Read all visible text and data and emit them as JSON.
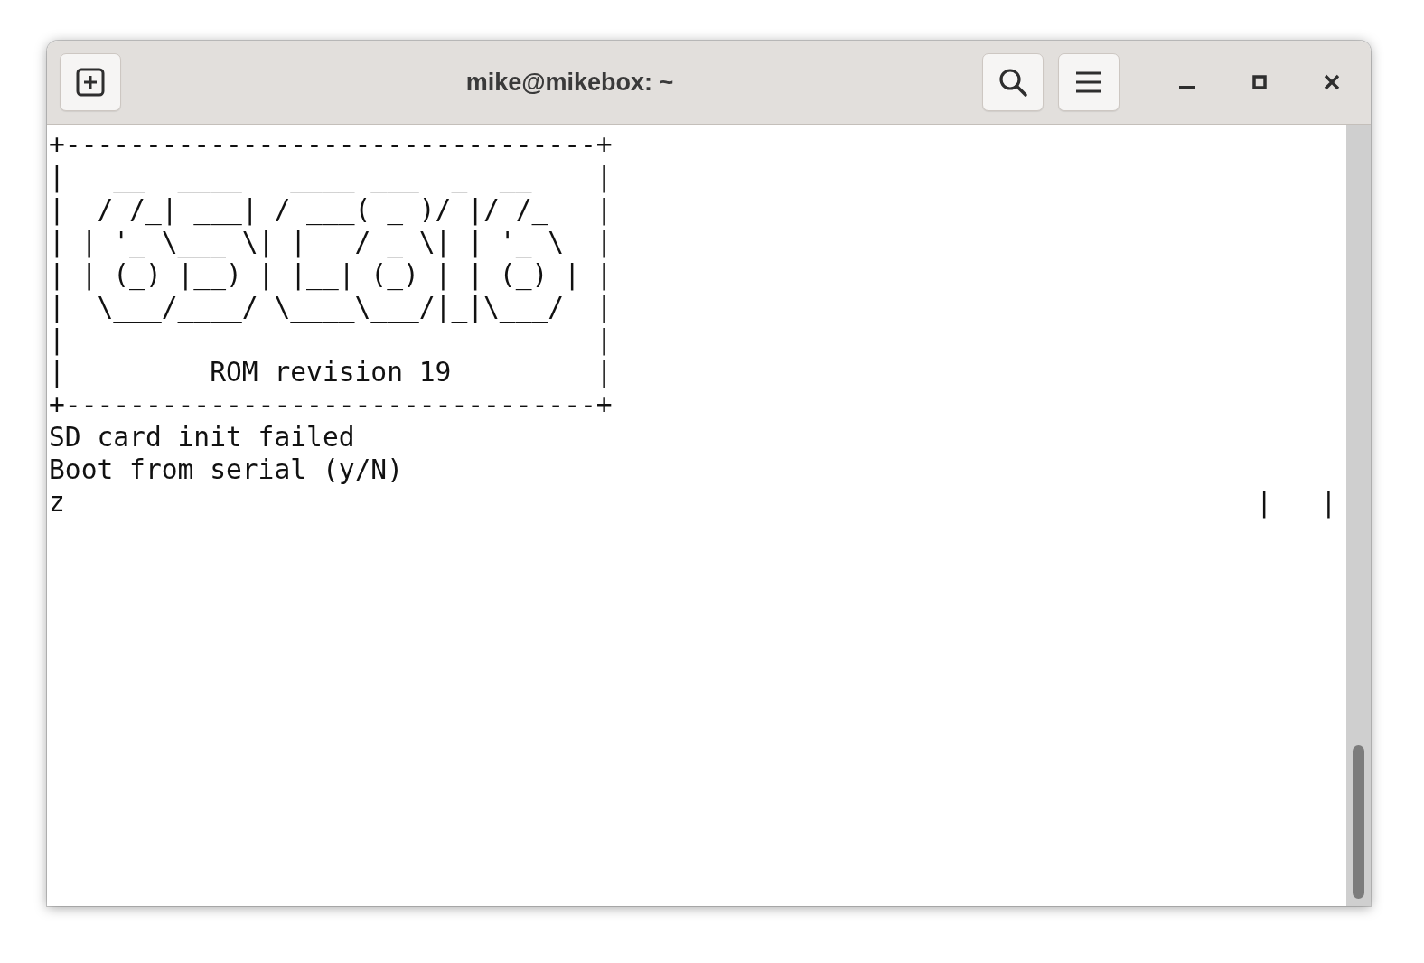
{
  "window": {
    "title": "mike@mikebox: ~"
  },
  "terminal": {
    "lines": [
      {
        "text": "+---------------------------------+"
      },
      {
        "text": "|   __  ____   ____ ___  _  __    |"
      },
      {
        "text": "|  / /_| ___| / ___( _ )/ |/ /_   |"
      },
      {
        "text": "| | '_ \\___ \\| |   / _ \\| | '_ \\  |"
      },
      {
        "text": "| | (_) |__) | |__| (_) | | (_) | |"
      },
      {
        "text": "|  \\___/____/ \\____\\___/|_|\\___/  |"
      },
      {
        "text": "|                                 |"
      },
      {
        "text": "|         ROM revision 19         |"
      },
      {
        "text": "+---------------------------------+"
      },
      {
        "text": "SD card init failed"
      },
      {
        "text": "Boot from serial (y/N)"
      },
      {
        "text": "z",
        "trailer": "|   |"
      }
    ]
  }
}
